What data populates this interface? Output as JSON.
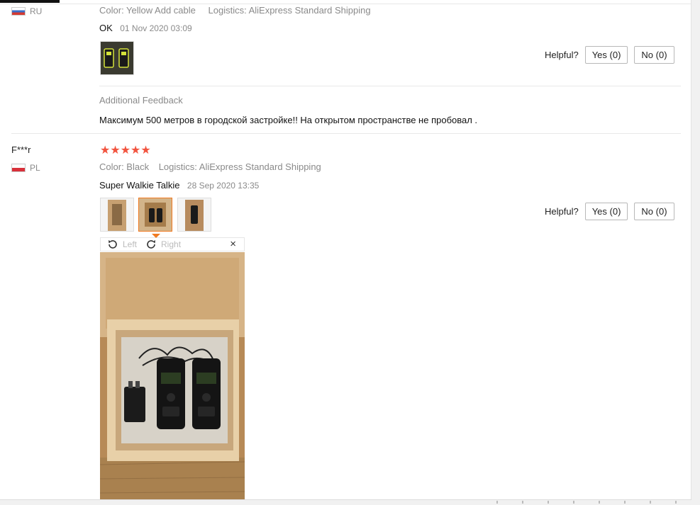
{
  "review1": {
    "country": "RU",
    "color": "Color: Yellow Add cable",
    "logistics": "Logistics: AliExpress Standard Shipping",
    "title": "OK",
    "date": "01 Nov 2020 03:09",
    "helpful": "Helpful?",
    "yes": "Yes (0)",
    "no": "No (0)",
    "additional_label": "Additional Feedback",
    "additional_text": "Максимум 500 метров в городской застройке!! На открытом пространстве не пробовал ."
  },
  "review2": {
    "user": "F***r",
    "country": "PL",
    "rating": 5,
    "stars": "★★★★★",
    "color": "Color: Black",
    "logistics": "Logistics: AliExpress Standard Shipping",
    "title": "Super Walkie Talkie",
    "date": "28 Sep 2020 13:35",
    "helpful": "Helpful?",
    "yes": "Yes (0)",
    "no": "No (0)"
  },
  "viewer": {
    "left": "Left",
    "right": "Right",
    "close": "×"
  }
}
